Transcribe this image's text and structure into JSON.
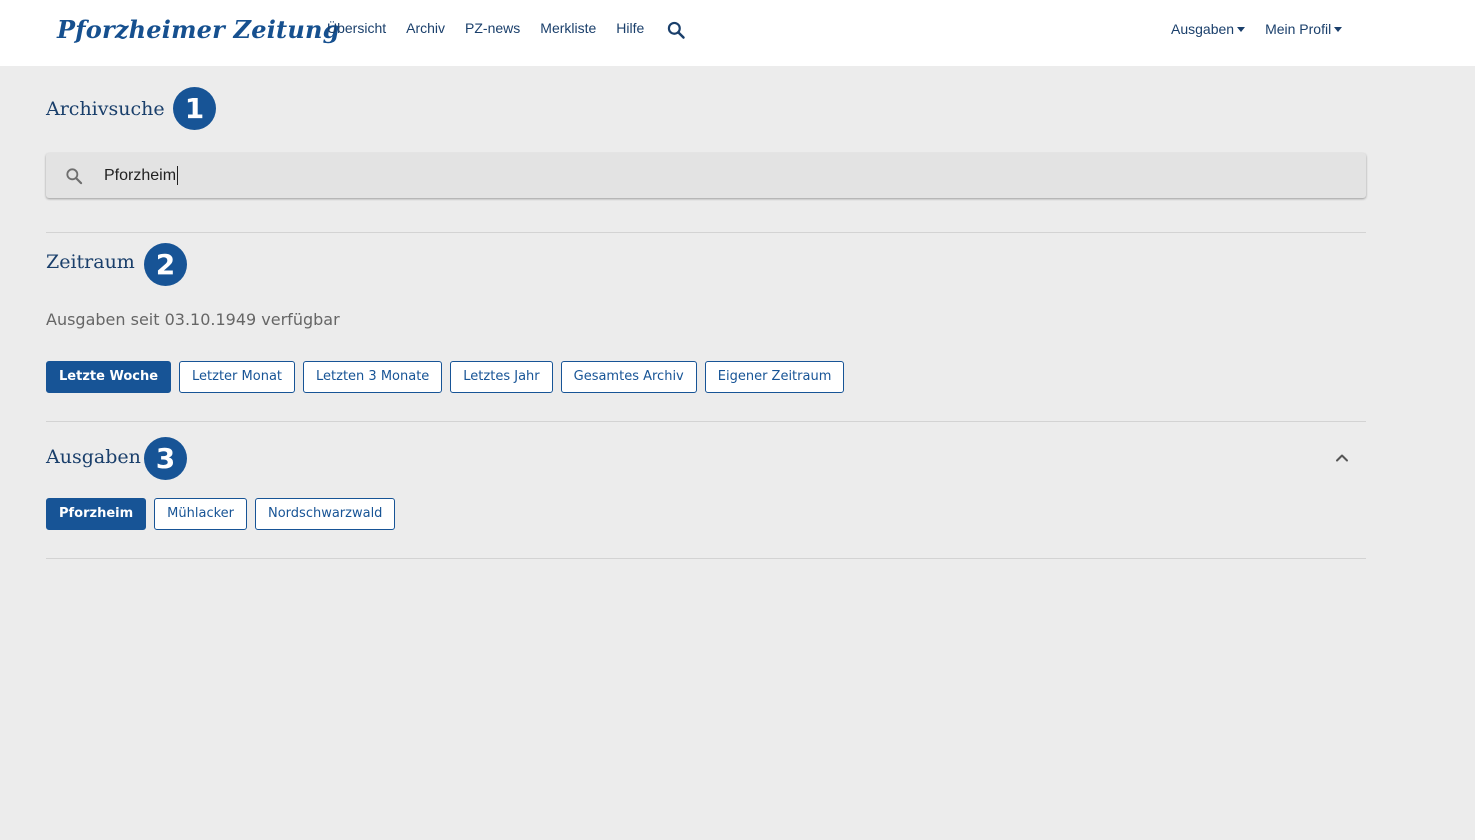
{
  "header": {
    "logo_text": "Pforzheimer Zeitung",
    "nav": [
      "Übersicht",
      "Archiv",
      "PZ-news",
      "Merkliste",
      "Hilfe"
    ],
    "right_nav": [
      "Ausgaben",
      "Mein Profil"
    ]
  },
  "search_section": {
    "title": "Archivsuche",
    "badge": "1",
    "query": "Pforzheim"
  },
  "period_section": {
    "title": "Zeitraum",
    "badge": "2",
    "availability": "Ausgaben seit 03.10.1949 verfügbar",
    "buttons": [
      "Letzte Woche",
      "Letzter Monat",
      "Letzten 3 Monate",
      "Letztes Jahr",
      "Gesamtes Archiv",
      "Eigener Zeitraum"
    ],
    "selected": "Letzte Woche"
  },
  "editions_section": {
    "title": "Ausgaben",
    "badge": "3",
    "buttons": [
      "Pforzheim",
      "Mühlacker",
      "Nordschwarzwald"
    ],
    "selected": "Pforzheim"
  },
  "colors": {
    "brand": "#175496",
    "text": "#1a3f6b",
    "background": "#ececec"
  }
}
